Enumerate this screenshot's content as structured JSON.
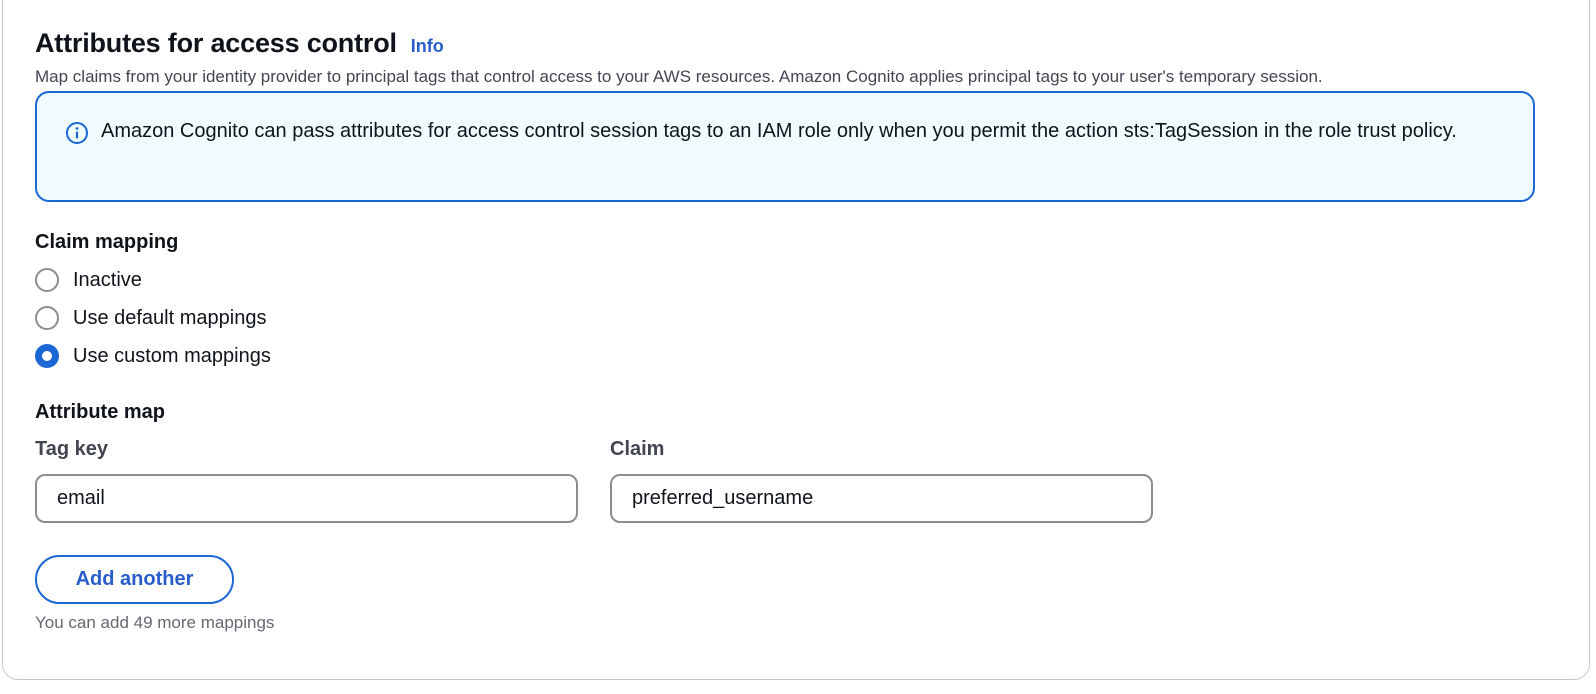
{
  "section": {
    "title": "Attributes for access control",
    "info_link": "Info",
    "description": "Map claims from your identity provider to principal tags that control access to your AWS resources. Amazon Cognito applies principal tags to your user's temporary session."
  },
  "alert": {
    "icon": "info-circle-icon",
    "type": "info",
    "text": "Amazon Cognito can pass attributes for access control session tags to an IAM role only when you permit the action sts:TagSession in the role trust policy."
  },
  "claim_mapping": {
    "label": "Claim mapping",
    "options": [
      {
        "label": "Inactive",
        "selected": false
      },
      {
        "label": "Use default mappings",
        "selected": false
      },
      {
        "label": "Use custom mappings",
        "selected": true
      }
    ]
  },
  "attribute_map": {
    "label": "Attribute map",
    "tag_key_label": "Tag key",
    "claim_label": "Claim",
    "rows": [
      {
        "tag_key": "email",
        "claim": "preferred_username"
      }
    ],
    "add_button_label": "Add another",
    "hint": "You can add 49 more mappings"
  },
  "colors": {
    "accent": "#1b67d4",
    "link": "#295eca",
    "alert_background": "#f0fbff"
  }
}
